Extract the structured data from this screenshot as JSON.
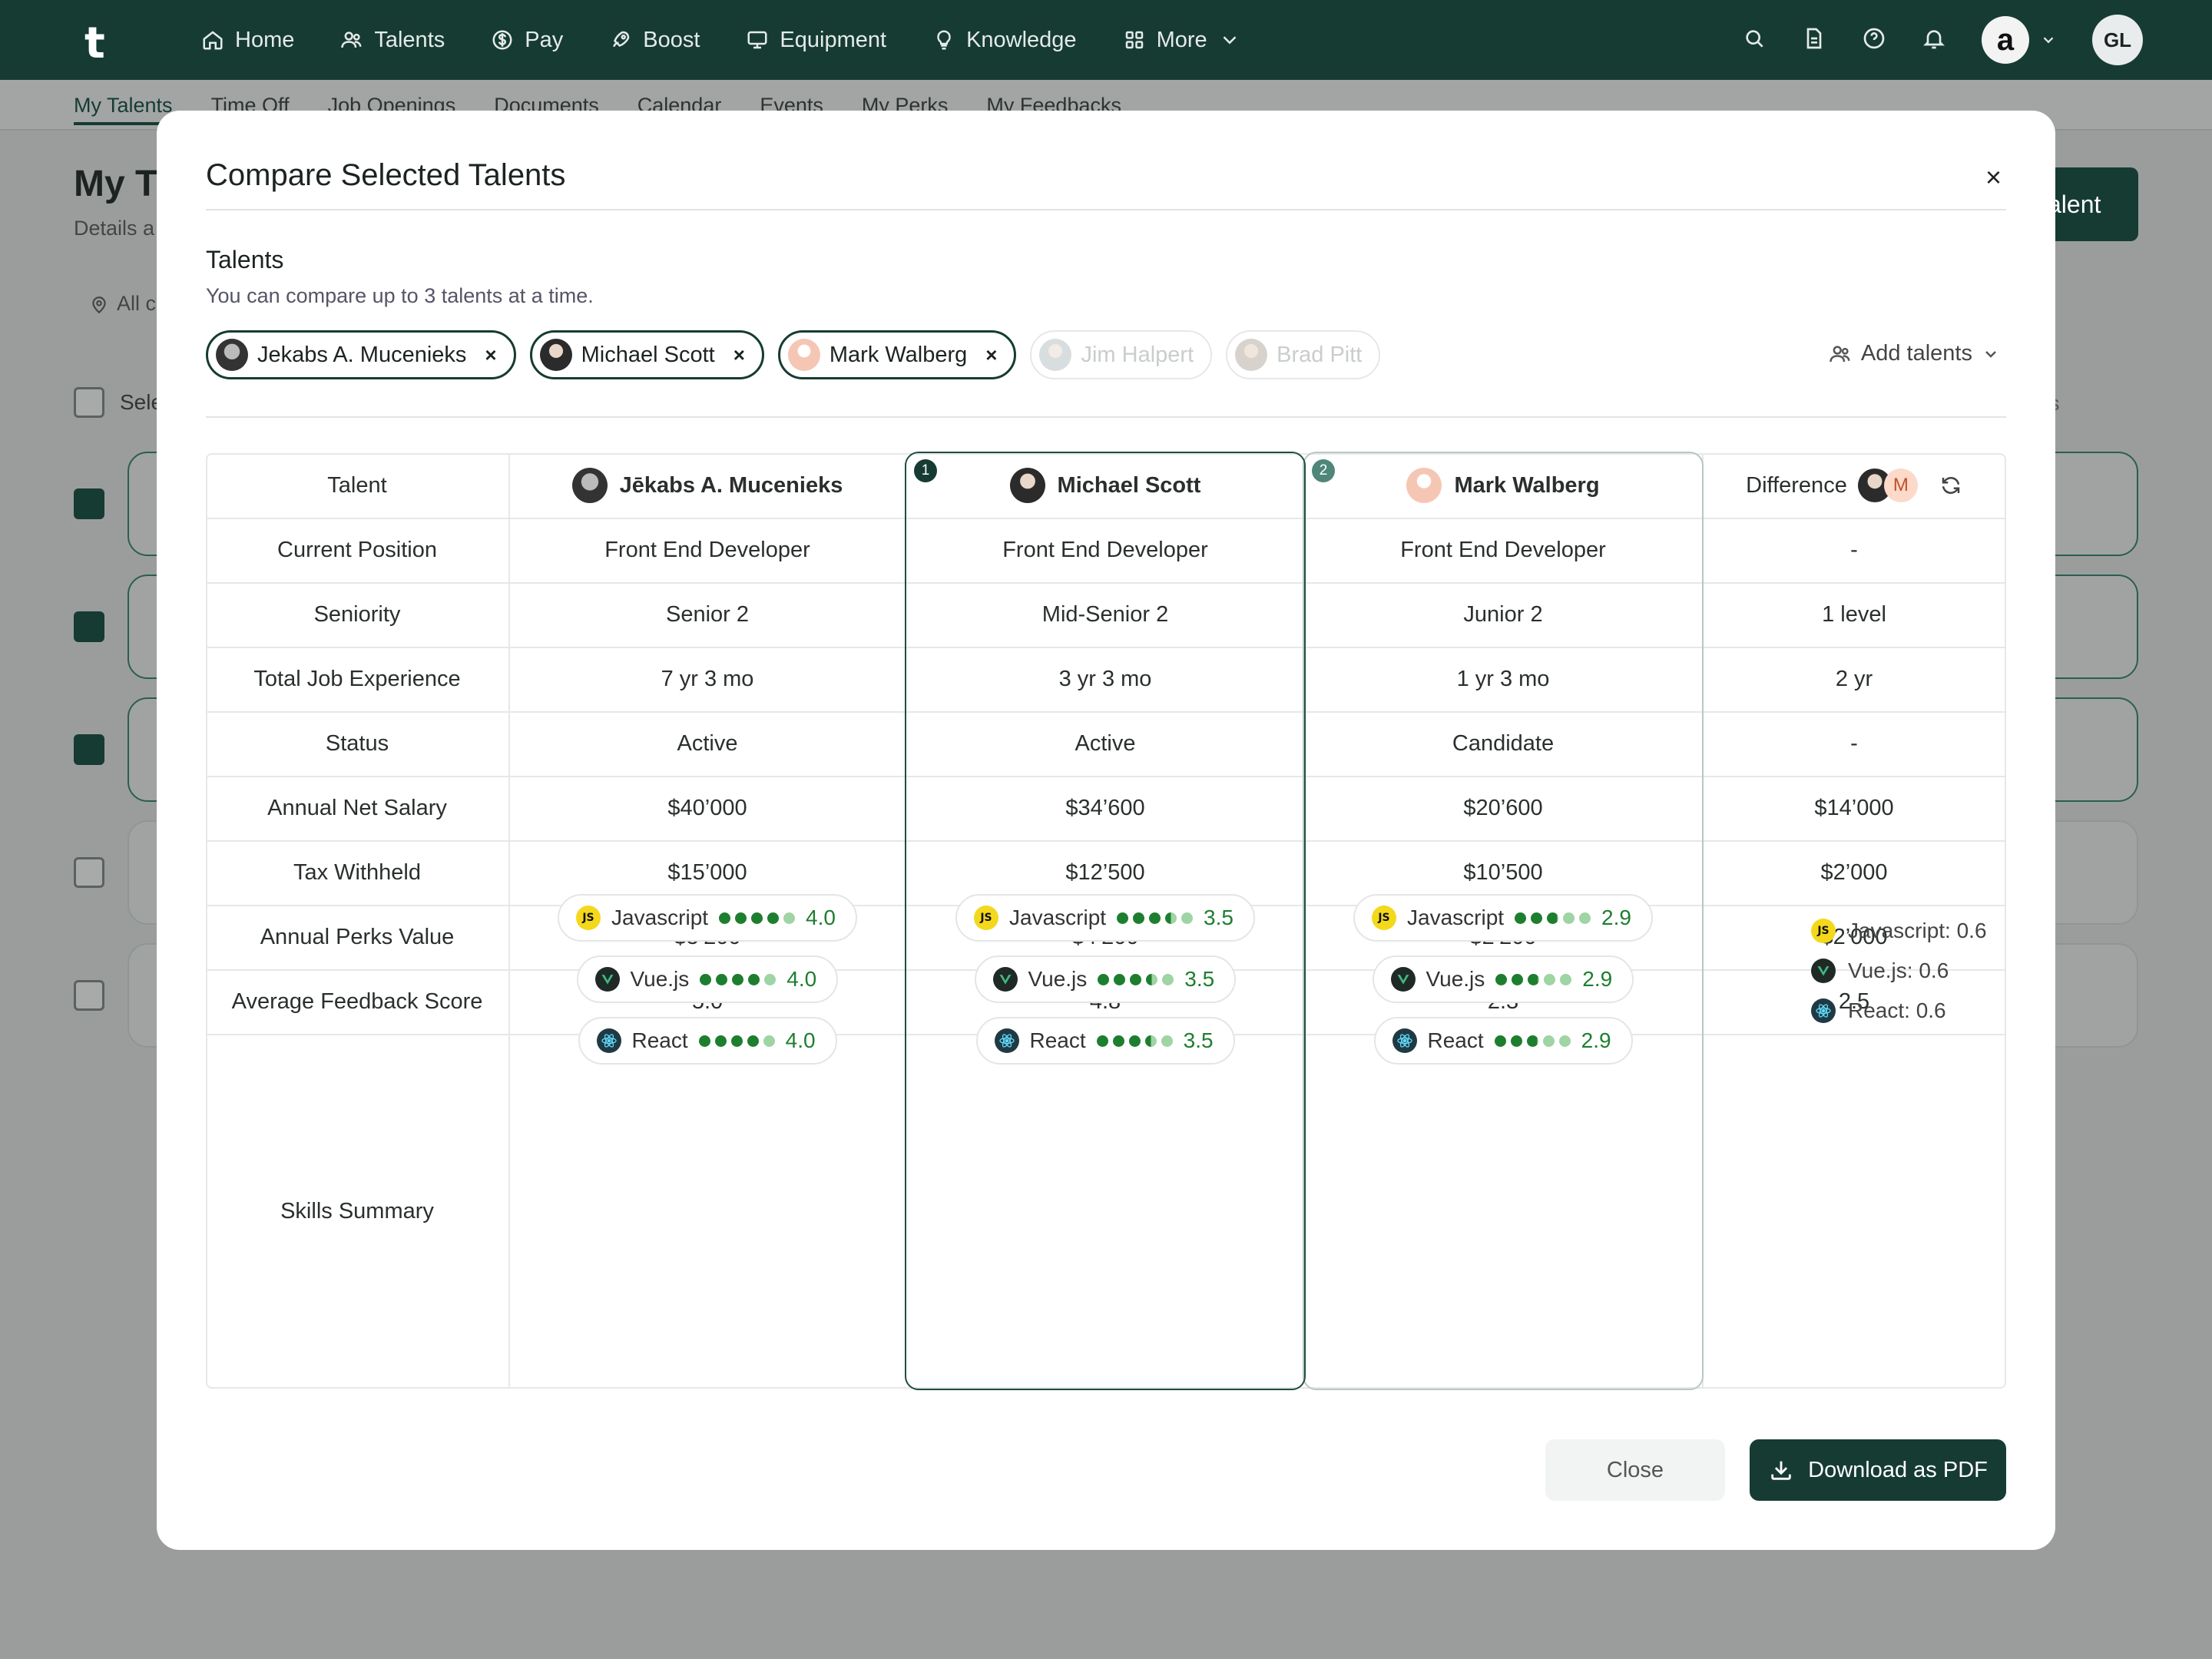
{
  "app": {
    "logo": "t"
  },
  "nav": {
    "items": [
      {
        "label": "Home",
        "icon": "home-icon"
      },
      {
        "label": "Talents",
        "icon": "users-icon"
      },
      {
        "label": "Pay",
        "icon": "dollar-icon"
      },
      {
        "label": "Boost",
        "icon": "rocket-icon"
      },
      {
        "label": "Equipment",
        "icon": "monitor-icon"
      },
      {
        "label": "Knowledge",
        "icon": "bulb-icon"
      },
      {
        "label": "More",
        "icon": "grid-icon"
      }
    ],
    "user_initials": "GL",
    "company_letter": "a"
  },
  "subnav": {
    "items": [
      "My Talents",
      "Time Off",
      "Job Openings",
      "Documents",
      "Calendar",
      "Events",
      "My Perks",
      "My Feedbacks"
    ]
  },
  "background": {
    "title": "My T",
    "subtitle": "Details a",
    "location_filter": "All c",
    "select_label": "Sele",
    "add_button": "alent",
    "skills_header": "ills"
  },
  "modal": {
    "title": "Compare Selected Talents",
    "close_icon": "×",
    "section_title": "Talents",
    "section_subtitle": "You can compare up to 3 talents at a time.",
    "chips": [
      {
        "name": "Jekabs A. Mucenieks",
        "selected": true
      },
      {
        "name": "Michael Scott",
        "selected": true
      },
      {
        "name": "Mark Walberg",
        "selected": true
      },
      {
        "name": "Jim Halpert",
        "selected": false
      },
      {
        "name": "Brad Pitt",
        "selected": false
      }
    ],
    "add_talents": "Add talents",
    "close_button": "Close",
    "download_button": "Download as PDF"
  },
  "table": {
    "header": {
      "label": "Talent",
      "talents": [
        "Jēkabs A. Mucenieks",
        "Michael Scott",
        "Mark Walberg"
      ],
      "difference": "Difference",
      "difference_avatar_letter": "M",
      "badges": [
        "1",
        "2"
      ]
    },
    "rows": [
      {
        "label": "Current Position",
        "values": [
          "Front End Developer",
          "Front End Developer",
          "Front End Developer"
        ],
        "diff": "-"
      },
      {
        "label": "Seniority",
        "values": [
          "Senior 2",
          "Mid-Senior 2",
          "Junior 2"
        ],
        "diff": "1 level"
      },
      {
        "label": "Total Job Experience",
        "values": [
          "7 yr 3 mo",
          "3 yr 3 mo",
          "1 yr 3 mo"
        ],
        "diff": "2 yr"
      },
      {
        "label": "Status",
        "values": [
          "Active",
          "Active",
          "Candidate"
        ],
        "diff": "-"
      },
      {
        "label": "Annual Net Salary",
        "values": [
          "$40’000",
          "$34’600",
          "$20’600"
        ],
        "diff": "$14’000"
      },
      {
        "label": "Tax Withheld",
        "values": [
          "$15’000",
          "$12’500",
          "$10’500"
        ],
        "diff": "$2’000"
      },
      {
        "label": "Annual Perks Value",
        "values": [
          "$5’200",
          "$4’200",
          "$2’200"
        ],
        "diff": "$2’000"
      },
      {
        "label": "Average Feedback Score",
        "values": [
          "5.0",
          "4.8",
          "2.3"
        ],
        "diff": "2.5"
      }
    ],
    "skills_label": "Skills Summary",
    "skills": [
      {
        "name": "Javascript",
        "icon": "javascript-icon",
        "scores": [
          "4.0",
          "3.5",
          "2.9"
        ],
        "levels": [
          4,
          3.5,
          2.9
        ],
        "diff": "Javascript: 0.6"
      },
      {
        "name": "Vue.js",
        "icon": "vuejs-icon",
        "scores": [
          "4.0",
          "3.5",
          "2.9"
        ],
        "levels": [
          4,
          3.5,
          2.9
        ],
        "diff": "Vue.js: 0.6"
      },
      {
        "name": "React",
        "icon": "react-icon",
        "scores": [
          "4.0",
          "3.5",
          "2.9"
        ],
        "levels": [
          4,
          3.5,
          2.9
        ],
        "diff": "React: 0.6"
      }
    ]
  },
  "colors": {
    "brand": "#163b33",
    "score_green": "#1e7e2f",
    "dot_light": "#9fd4a4"
  }
}
